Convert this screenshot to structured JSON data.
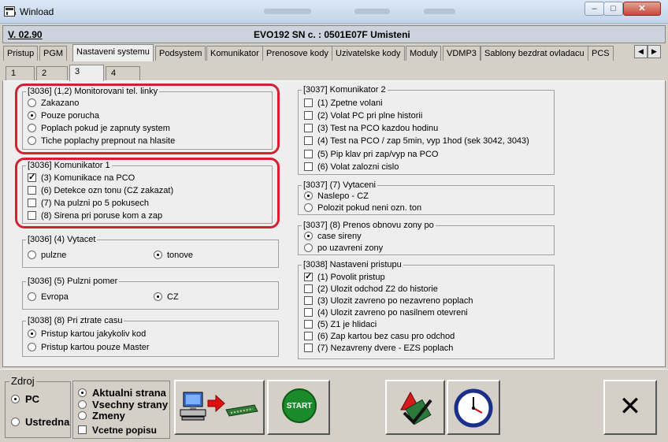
{
  "window": {
    "title": "Winload"
  },
  "header": {
    "version": "V. 02.90",
    "device": "EVO192   SN c. : 0501E07F Umisteni"
  },
  "tabs": [
    {
      "label": "Pristup"
    },
    {
      "label": "PGM"
    },
    {
      "label": "Nastaveni systemu"
    },
    {
      "label": "Podsystem"
    },
    {
      "label": "Komunikator"
    },
    {
      "label": "Prenosove kody"
    },
    {
      "label": "Uzivatelske kody"
    },
    {
      "label": "Moduly"
    },
    {
      "label": "VDMP3"
    },
    {
      "label": "Sablony bezdrat ovladacu"
    },
    {
      "label": "PCS"
    }
  ],
  "subtabs": [
    {
      "label": "1"
    },
    {
      "label": "2"
    },
    {
      "label": "3"
    },
    {
      "label": "4"
    }
  ],
  "groups": {
    "monitor": {
      "legend": "[3036]  (1,2) Monitorovani tel. linky",
      "options": [
        "Zakazano",
        "Pouze porucha",
        "Poplach pokud je zapnuty system",
        "Tiche poplachy prepnout na hlasite"
      ],
      "selected": 1
    },
    "kom1": {
      "legend": "[3036]  Komunikator 1",
      "options": [
        "(3) Komunikace na PCO",
        "(6) Detekce ozn tonu (CZ zakazat)",
        "(7) Na pulzni po 5 pokusech",
        "(8) Sirena pri poruse kom a zap"
      ],
      "checked": [
        0
      ]
    },
    "vytacet": {
      "legend": "[3036] (4)  Vytacet",
      "options": [
        "pulzne",
        "tonove"
      ],
      "selected": 1
    },
    "pulzni": {
      "legend": "[3036] (5)  Pulzni pomer",
      "options": [
        "Evropa",
        "CZ"
      ],
      "selected": 1
    },
    "ztrata": {
      "legend": "[3038] (8)  Pri ztrate casu",
      "options": [
        "Pristup kartou jakykoliv kod",
        "Pristup kartou pouze Master"
      ],
      "selected": 0
    },
    "kom2": {
      "legend": "[3037]  Komunikator 2",
      "options": [
        "(1) Zpetne volani",
        "(2) Volat PC pri plne historii",
        "(3) Test na PCO kazdou hodinu",
        "(4) Test na PCO / zap 5min, vyp 1hod (sek 3042, 3043)",
        "(5) Pip klav pri zap/vyp na PCO",
        "(6) Volat zalozni cislo"
      ],
      "checked": []
    },
    "vytaceni": {
      "legend": "[3037] (7)  Vytaceni",
      "options": [
        "Naslepo - CZ",
        "Polozit pokud neni ozn. ton"
      ],
      "selected": 0
    },
    "obnova": {
      "legend": "[3037] (8)  Prenos obnovu zony po",
      "options": [
        "case sireny",
        "po uzavreni zony"
      ],
      "selected": 0
    },
    "pristup": {
      "legend": "[3038]  Nastaveni pristupu",
      "options": [
        "(1) Povolit pristup",
        "(2) Ulozit odchod Z2 do historie",
        "(3) Ulozit zavreno po nezavreno poplach",
        "(4) Ulozit zavreno po nasilnem otevreni",
        "(5) Z1 je hlidaci",
        "(6) Zap kartou bez casu pro odchod",
        "(7) Nezavreny dvere - EZS poplach"
      ],
      "checked": [
        0
      ]
    }
  },
  "bottom": {
    "zdroj_legend": "Zdroj",
    "zdroj_options": [
      "PC",
      "Ustredna"
    ],
    "zdroj_selected": 0,
    "pages_options": [
      "Aktualni strana",
      "Vsechny strany",
      "Zmeny"
    ],
    "pages_selected": 0,
    "include_desc": "Vcetne popisu",
    "start_label": "START",
    "exit_label": "✕"
  },
  "colors": {
    "highlight_ring": "#d42031",
    "start_button": "#1a8a2a"
  }
}
